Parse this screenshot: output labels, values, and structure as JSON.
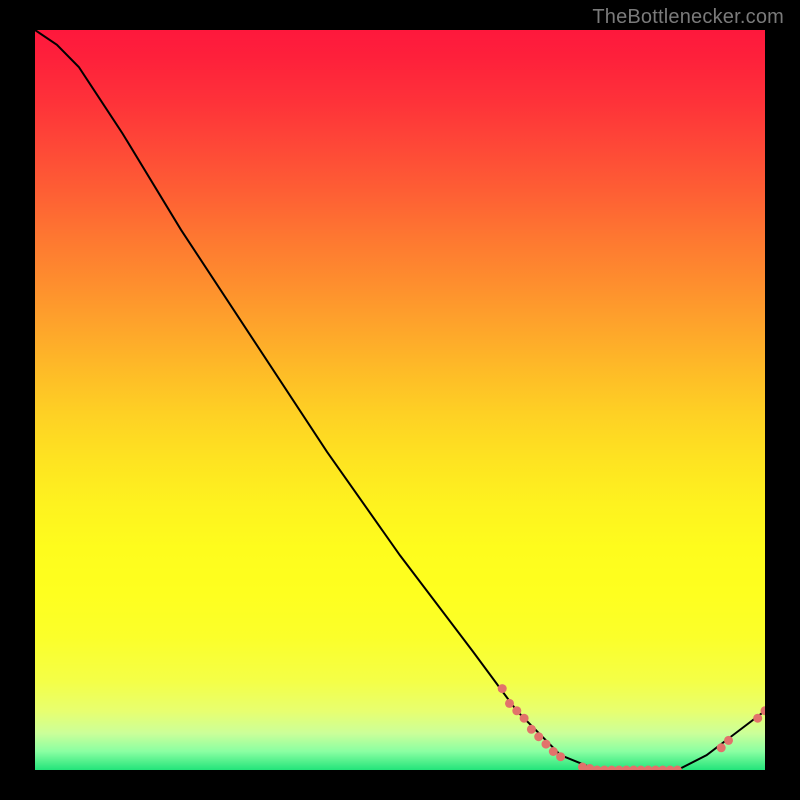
{
  "attribution": "TheBottlenecker.com",
  "chart_data": {
    "type": "line",
    "title": "",
    "xlabel": "",
    "ylabel": "",
    "xlim": [
      0,
      100
    ],
    "ylim": [
      0,
      100
    ],
    "series": [
      {
        "name": "curve",
        "points": [
          {
            "x": 0,
            "y": 100
          },
          {
            "x": 3,
            "y": 98
          },
          {
            "x": 6,
            "y": 95
          },
          {
            "x": 8,
            "y": 92
          },
          {
            "x": 12,
            "y": 86
          },
          {
            "x": 20,
            "y": 73
          },
          {
            "x": 30,
            "y": 58
          },
          {
            "x": 40,
            "y": 43
          },
          {
            "x": 50,
            "y": 29
          },
          {
            "x": 60,
            "y": 16
          },
          {
            "x": 66,
            "y": 8
          },
          {
            "x": 72,
            "y": 2
          },
          {
            "x": 77,
            "y": 0
          },
          {
            "x": 88,
            "y": 0
          },
          {
            "x": 92,
            "y": 2
          },
          {
            "x": 96,
            "y": 5
          },
          {
            "x": 100,
            "y": 8
          }
        ]
      }
    ],
    "markers": [
      {
        "x": 64,
        "y": 11
      },
      {
        "x": 65,
        "y": 9
      },
      {
        "x": 66,
        "y": 8
      },
      {
        "x": 67,
        "y": 7
      },
      {
        "x": 68,
        "y": 5.5
      },
      {
        "x": 69,
        "y": 4.5
      },
      {
        "x": 70,
        "y": 3.5
      },
      {
        "x": 71,
        "y": 2.5
      },
      {
        "x": 72,
        "y": 1.8
      },
      {
        "x": 75,
        "y": 0.4
      },
      {
        "x": 76,
        "y": 0.2
      },
      {
        "x": 77,
        "y": 0
      },
      {
        "x": 78,
        "y": 0
      },
      {
        "x": 79,
        "y": 0
      },
      {
        "x": 80,
        "y": 0
      },
      {
        "x": 81,
        "y": 0
      },
      {
        "x": 82,
        "y": 0
      },
      {
        "x": 83,
        "y": 0
      },
      {
        "x": 84,
        "y": 0
      },
      {
        "x": 85,
        "y": 0
      },
      {
        "x": 86,
        "y": 0
      },
      {
        "x": 87,
        "y": 0
      },
      {
        "x": 88,
        "y": 0
      },
      {
        "x": 94,
        "y": 3
      },
      {
        "x": 95,
        "y": 4
      },
      {
        "x": 99,
        "y": 7
      },
      {
        "x": 100,
        "y": 8
      }
    ],
    "gradient_bands": [
      {
        "color": "#fe183c",
        "stop": 0.0
      },
      {
        "color": "#fe213b",
        "stop": 0.04
      },
      {
        "color": "#fe3339",
        "stop": 0.1
      },
      {
        "color": "#fe4937",
        "stop": 0.16
      },
      {
        "color": "#fe5f34",
        "stop": 0.22
      },
      {
        "color": "#fe7731",
        "stop": 0.28
      },
      {
        "color": "#fe8d2e",
        "stop": 0.34
      },
      {
        "color": "#fea42b",
        "stop": 0.4
      },
      {
        "color": "#febb27",
        "stop": 0.46
      },
      {
        "color": "#fed124",
        "stop": 0.52
      },
      {
        "color": "#fee321",
        "stop": 0.58
      },
      {
        "color": "#fef21f",
        "stop": 0.64
      },
      {
        "color": "#fefc1d",
        "stop": 0.7
      },
      {
        "color": "#feff1f",
        "stop": 0.76
      },
      {
        "color": "#fbff2a",
        "stop": 0.82
      },
      {
        "color": "#f4ff47",
        "stop": 0.88
      },
      {
        "color": "#e8ff6f",
        "stop": 0.92
      },
      {
        "color": "#ccff99",
        "stop": 0.95
      },
      {
        "color": "#8affa2",
        "stop": 0.975
      },
      {
        "color": "#23e47a",
        "stop": 1.0
      }
    ]
  },
  "colors": {
    "marker": "#e2726b",
    "line": "#000000"
  }
}
